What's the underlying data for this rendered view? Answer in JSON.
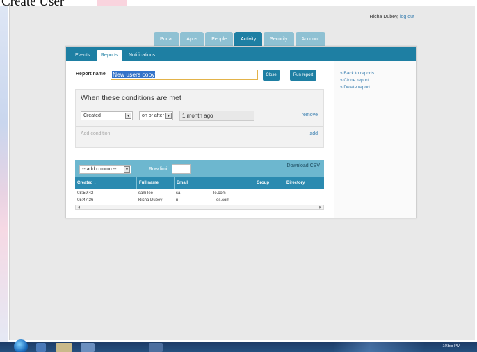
{
  "slide": {
    "title": "Create User"
  },
  "user": {
    "name": "Richa Dubey,",
    "logout": "log out"
  },
  "top_tabs": [
    {
      "label": "Portal",
      "active": false
    },
    {
      "label": "Apps",
      "active": false
    },
    {
      "label": "People",
      "active": false
    },
    {
      "label": "Activity",
      "active": true
    },
    {
      "label": "Security",
      "active": false
    },
    {
      "label": "Account",
      "active": false
    }
  ],
  "sub_tabs": {
    "events": "Events",
    "reports": "Reports",
    "notifications": "Notifications"
  },
  "report": {
    "name_label": "Report name",
    "name_value": "New users copy",
    "close_button": "Close",
    "run_button": "Run report"
  },
  "conditions": {
    "title": "When these conditions are met",
    "field": "Created",
    "operator": "on or after",
    "value": "1 month ago",
    "remove": "remove",
    "add_placeholder": "Add condition",
    "add": "add"
  },
  "toolbar": {
    "add_column": "-- add column --",
    "row_limit_label": "Row limit",
    "download_csv": "Download CSV"
  },
  "table": {
    "headers": [
      "Created ↓",
      "Full name",
      "Email",
      "Group",
      "Directory"
    ],
    "rows": [
      {
        "created": "08:59:42",
        "full_name": "sam lee",
        "email_start": "sa",
        "email_end": "le.com"
      },
      {
        "created": "05:47:36",
        "full_name": "Richa Dubey",
        "email_start": "ri",
        "email_end": "es.com"
      }
    ]
  },
  "sidebar": {
    "links": [
      "» Back to reports",
      "» Clone report",
      "» Delete report"
    ]
  },
  "taskbar": {
    "clock": "10:55 PM"
  },
  "colors": {
    "primary": "#1e7fa3",
    "tab_inactive": "#8fc1d3",
    "link": "#3a7fb0",
    "toolbar": "#6db7cf"
  }
}
